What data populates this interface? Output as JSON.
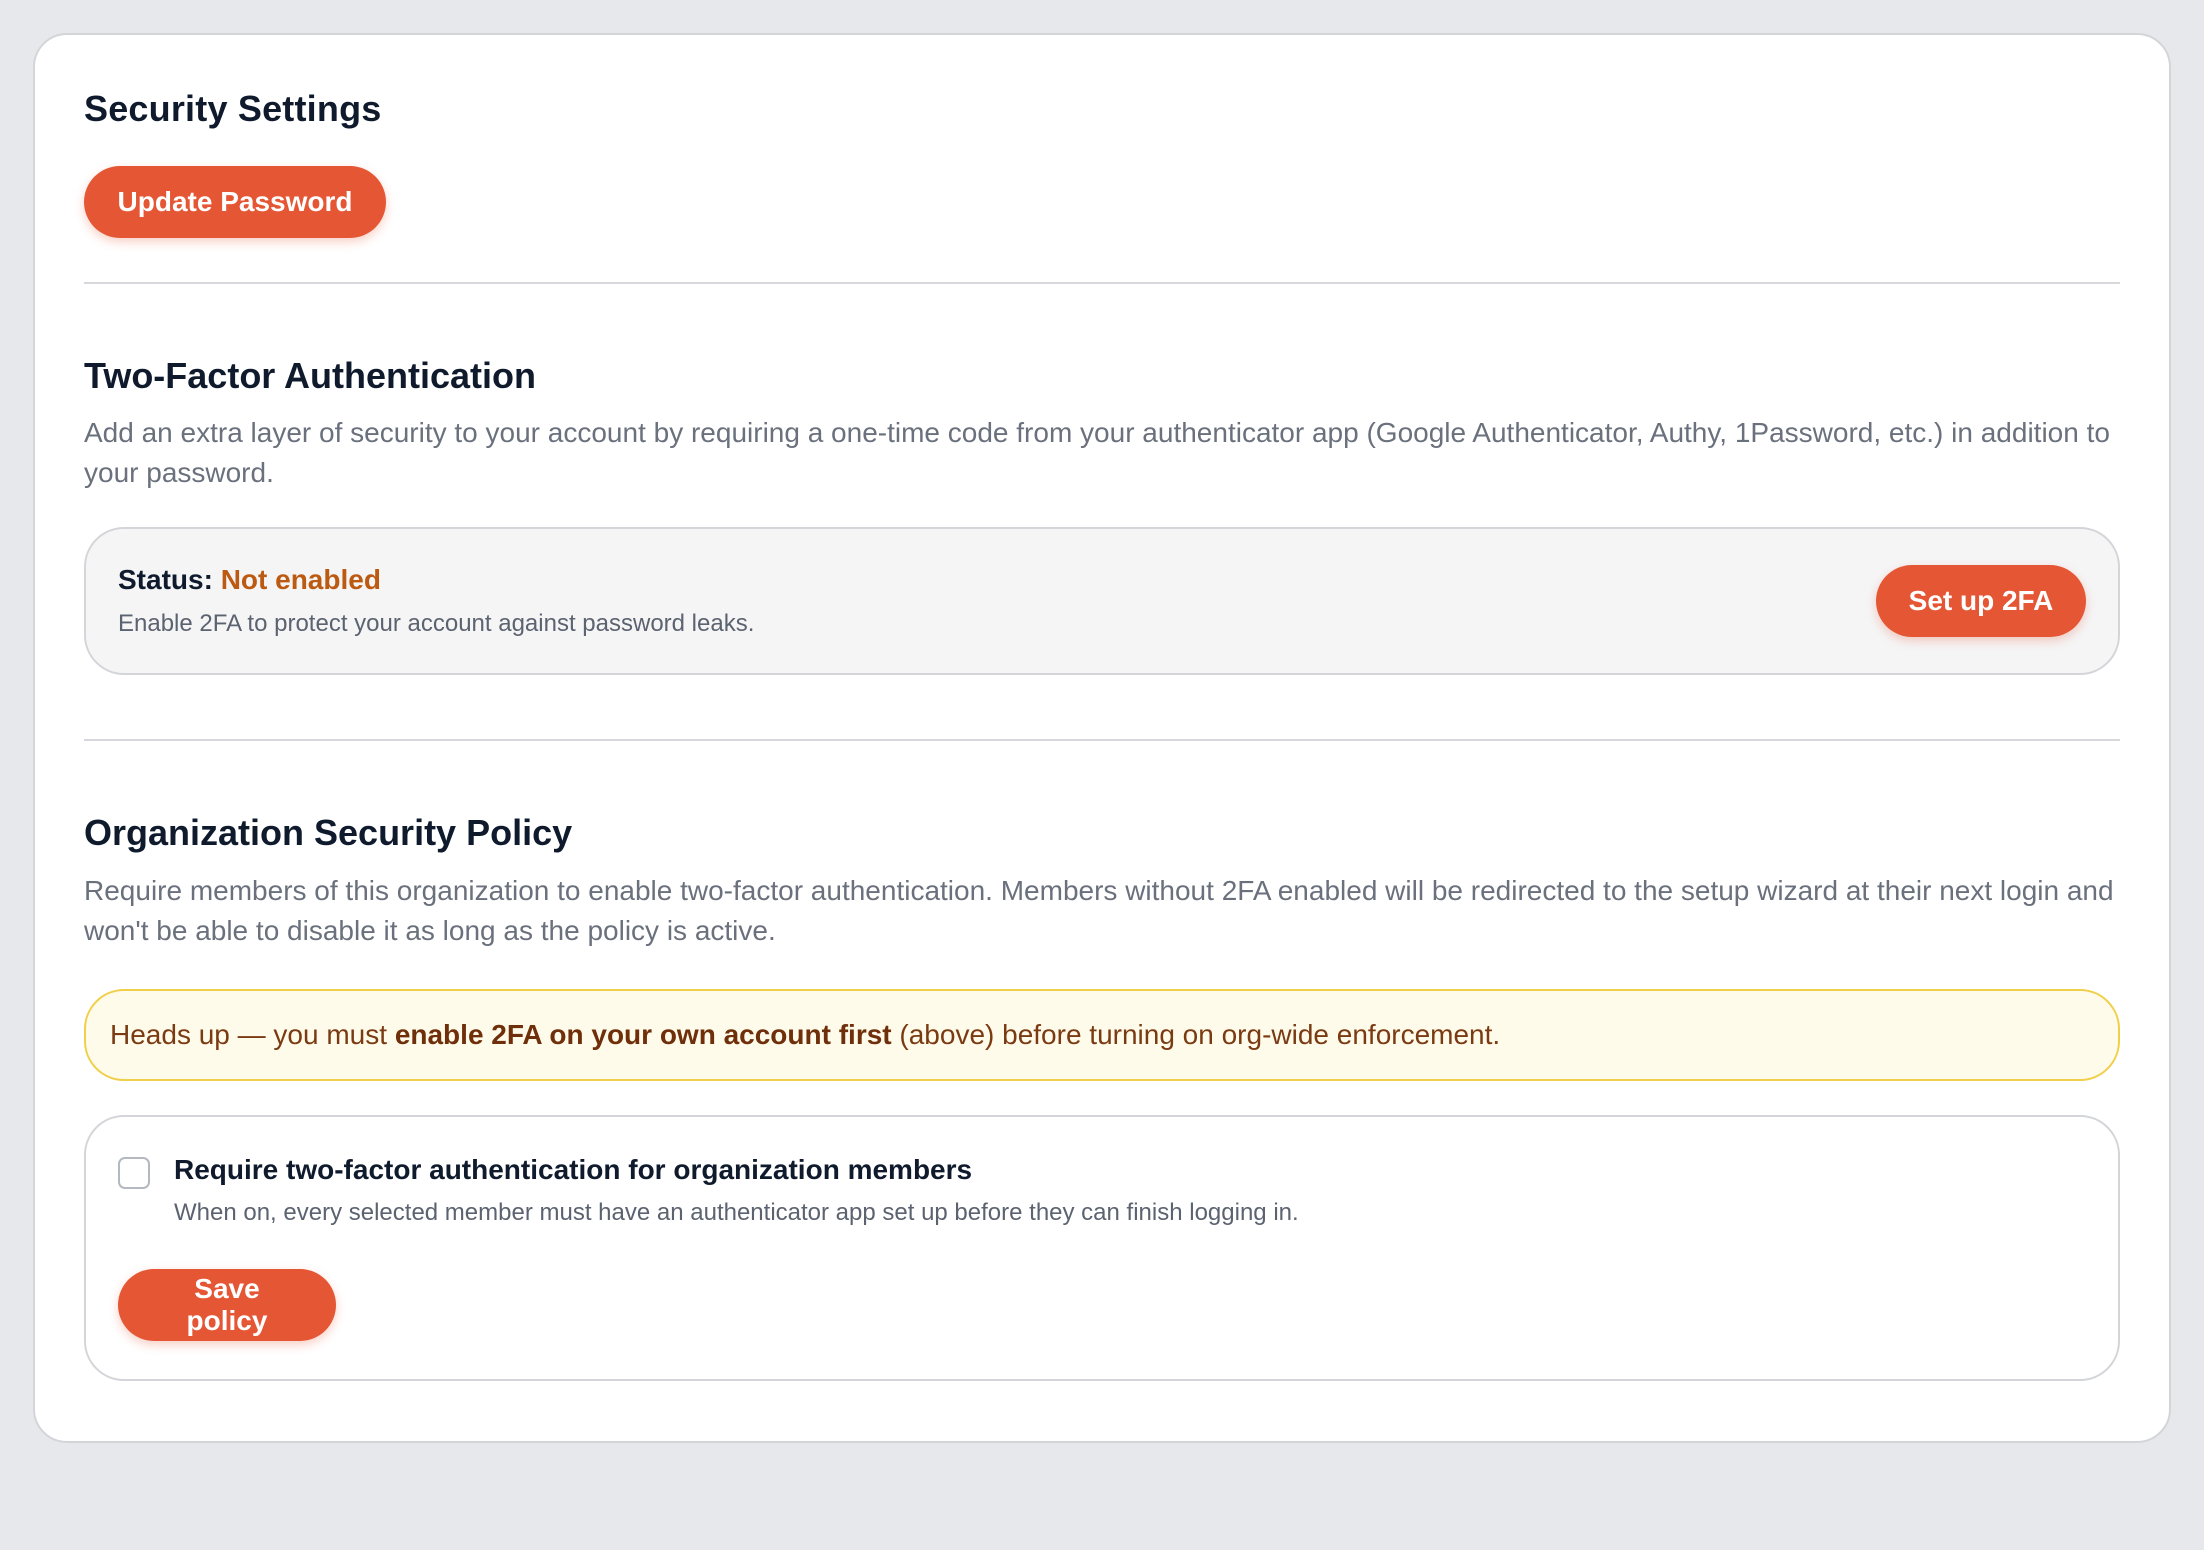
{
  "security": {
    "title": "Security Settings",
    "update_password_label": "Update Password"
  },
  "two_factor": {
    "title": "Two-Factor Authentication",
    "description": "Add an extra layer of security to your account by requiring a one-time code from your authenticator app (Google Authenticator, Authy, 1Password, etc.) in addition to your password.",
    "status_label": "Status:",
    "status_value": "Not enabled",
    "status_hint": "Enable 2FA to protect your account against password leaks.",
    "setup_button_label": "Set up 2FA"
  },
  "org_policy": {
    "title": "Organization Security Policy",
    "description": "Require members of this organization to enable two-factor authentication. Members without 2FA enabled will be redirected to the setup wizard at their next login and won't be able to disable it as long as the policy is active.",
    "alert_prefix": "Heads up — you must ",
    "alert_emphasis": "enable 2FA on your own account first",
    "alert_suffix": " (above) before turning on org-wide enforcement.",
    "require_label": "Require two-factor authentication for organization members",
    "require_hint": "When on, every selected member must have an authenticator app set up before they can finish logging in.",
    "require_checked": false,
    "save_button_label": "Save policy"
  },
  "colors": {
    "accent": "#e55634",
    "status_warning": "#bd5a12",
    "alert_bg": "#fffbeb",
    "alert_border": "#f0cf4a"
  }
}
